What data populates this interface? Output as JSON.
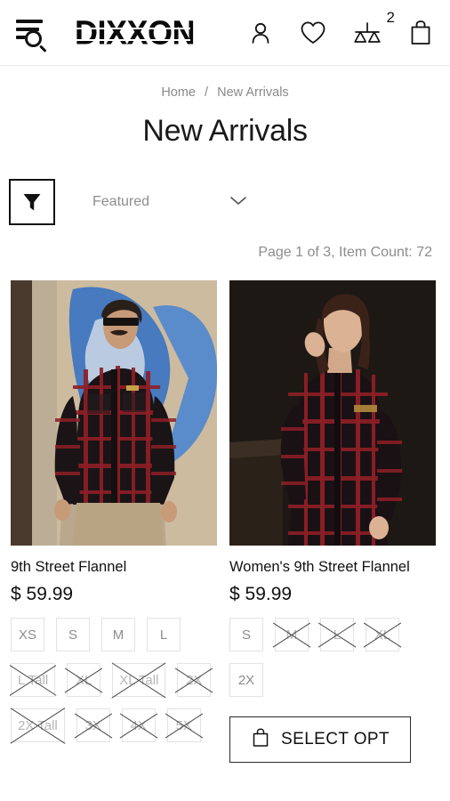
{
  "header": {
    "menu_search_icon": "menu-search-icon",
    "brand": "DIXXON",
    "account_icon": "account-icon",
    "wishlist_icon": "heart-icon",
    "compare_icon": "compare-scales-icon",
    "compare_badge": "2",
    "cart_icon": "shopping-bag-icon"
  },
  "breadcrumb": {
    "home": "Home",
    "separator": "/",
    "current": "New Arrivals"
  },
  "page": {
    "title": "New Arrivals",
    "count_text": "Page 1 of 3, Item Count: 72"
  },
  "toolbar": {
    "filter_icon": "filter-funnel-icon",
    "sort_value": "Featured",
    "caret_icon": "chevron-down-icon"
  },
  "products": [
    {
      "title": "9th Street Flannel",
      "price": "$ 59.99",
      "image_alt": "man-wearing-red-black-plaid-flannel-graffiti-wall",
      "sizes": [
        {
          "label": "XS",
          "sold_out": false
        },
        {
          "label": "S",
          "sold_out": false
        },
        {
          "label": "M",
          "sold_out": false
        },
        {
          "label": "L",
          "sold_out": false
        },
        {
          "label": "L Tall",
          "sold_out": true
        },
        {
          "label": "XL",
          "sold_out": true
        },
        {
          "label": "XL Tall",
          "sold_out": true
        },
        {
          "label": "2X",
          "sold_out": true
        },
        {
          "label": "2X Tall",
          "sold_out": true
        },
        {
          "label": "3X",
          "sold_out": true
        },
        {
          "label": "4X",
          "sold_out": true
        },
        {
          "label": "5X",
          "sold_out": true
        }
      ],
      "has_select_button": false,
      "select_label": ""
    },
    {
      "title": "Women's 9th Street Flannel",
      "price": "$ 59.99",
      "image_alt": "woman-wearing-red-black-plaid-flannel-dark-background",
      "sizes": [
        {
          "label": "S",
          "sold_out": false
        },
        {
          "label": "M",
          "sold_out": true
        },
        {
          "label": "L",
          "sold_out": true
        },
        {
          "label": "XL",
          "sold_out": true
        },
        {
          "label": "2X",
          "sold_out": false
        }
      ],
      "has_select_button": true,
      "select_label": "SELECT OPT",
      "select_icon": "shopping-bag-icon"
    }
  ],
  "colors": {
    "text_dark": "#111111",
    "text_muted": "#8c8c8c",
    "border_light": "#e3e3e3",
    "flannel_red": "#8e1f26",
    "flannel_black": "#1a1416",
    "graffiti_blue": "#2f6fc4"
  }
}
